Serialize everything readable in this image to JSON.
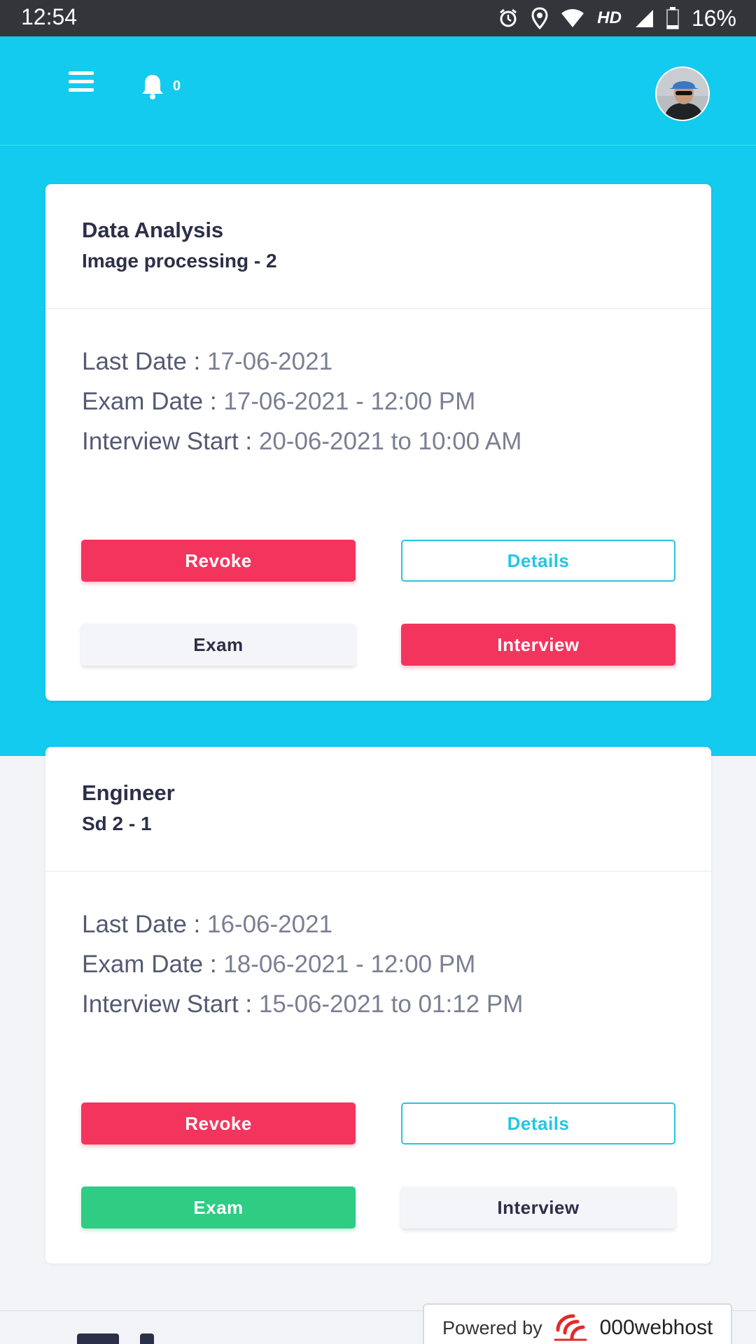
{
  "status_bar": {
    "time": "12:54",
    "network": "HD",
    "battery": "16%"
  },
  "header": {
    "notification_count": "0",
    "colors": {
      "accent": "#12cbee"
    }
  },
  "cards": [
    {
      "title": "Data Analysis",
      "subtitle": "Image processing - 2",
      "last_date_label": "Last Date :",
      "last_date": "17-06-2021",
      "exam_date_label": "Exam Date :",
      "exam_date": "17-06-2021 - 12:00 PM",
      "interview_label": "Interview Start :",
      "interview": "20-06-2021 to 10:00 AM",
      "buttons": {
        "revoke": "Revoke",
        "details": "Details",
        "exam": "Exam",
        "interview": "Interview"
      }
    },
    {
      "title": "Engineer",
      "subtitle": "Sd 2 - 1",
      "last_date_label": "Last Date :",
      "last_date": "16-06-2021",
      "exam_date_label": "Exam Date :",
      "exam_date": "18-06-2021 - 12:00 PM",
      "interview_label": "Interview Start :",
      "interview": "15-06-2021 to 01:12 PM",
      "buttons": {
        "revoke": "Revoke",
        "details": "Details",
        "exam": "Exam",
        "interview": "Interview"
      }
    }
  ],
  "footer": {
    "powered_label": "Powered by",
    "powered_brand": "000webhost"
  },
  "colors": {
    "red": "#f3355e",
    "green": "#2fcc83",
    "cyan_outline": "#24c6e0",
    "dark_text": "#2c2f48"
  }
}
